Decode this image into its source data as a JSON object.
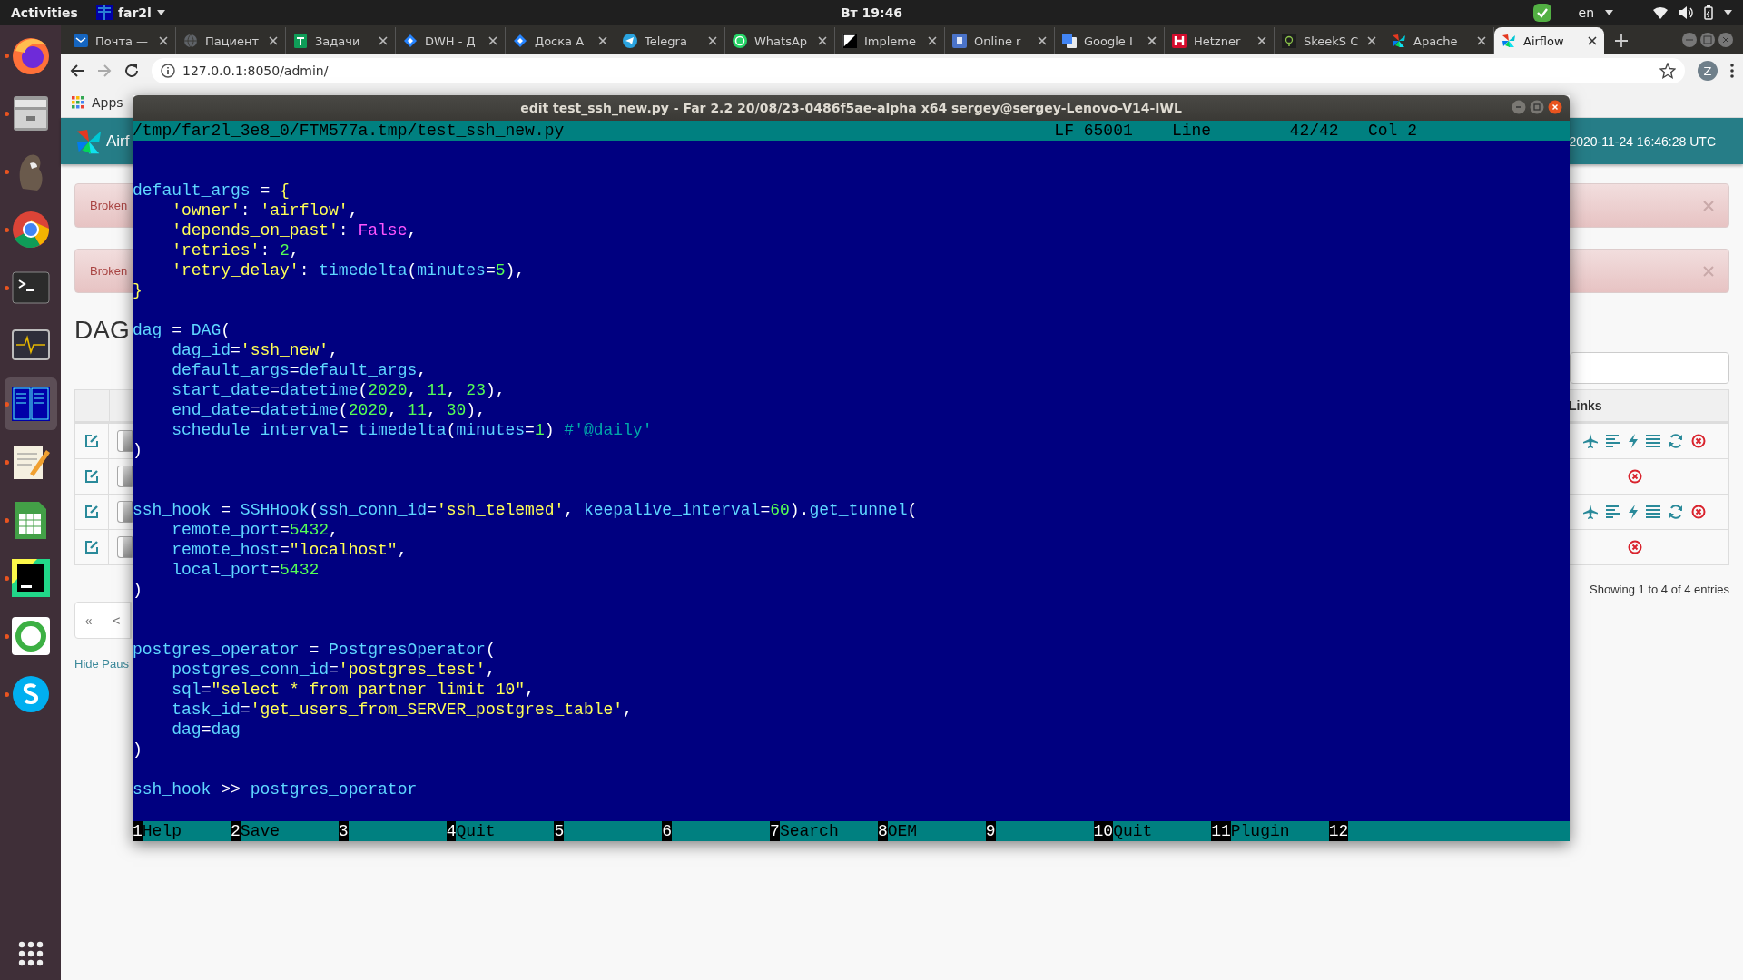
{
  "top_bar": {
    "activities": "Activities",
    "app_menu": "far2l",
    "clock": "Вт 19:46",
    "keyboard_layout": "en"
  },
  "dock": {
    "apps": [
      {
        "kind": "firefox",
        "running": true,
        "selected": false
      },
      {
        "kind": "files",
        "running": true,
        "selected": false
      },
      {
        "kind": "beaver",
        "running": true,
        "selected": false
      },
      {
        "kind": "chrome",
        "running": true,
        "selected": false
      },
      {
        "kind": "terminal",
        "running": true,
        "selected": false
      },
      {
        "kind": "monitor",
        "running": false,
        "selected": false
      },
      {
        "kind": "far",
        "running": true,
        "selected": true
      },
      {
        "kind": "editor",
        "running": true,
        "selected": false
      },
      {
        "kind": "calc",
        "running": true,
        "selected": false
      },
      {
        "kind": "pycharm",
        "running": true,
        "selected": false
      },
      {
        "kind": "ring",
        "running": true,
        "selected": false
      },
      {
        "kind": "skype",
        "running": true,
        "selected": false
      }
    ]
  },
  "browser": {
    "tabs": [
      {
        "label": "Почта —",
        "kind": "mail",
        "selected": false
      },
      {
        "label": "Пациент",
        "kind": "globe",
        "selected": false
      },
      {
        "label": "Задачи",
        "kind": "sheet",
        "selected": false
      },
      {
        "label": "DWH - Д",
        "kind": "diamond",
        "selected": false
      },
      {
        "label": "Доска А",
        "kind": "diamond",
        "selected": false
      },
      {
        "label": "Telegra",
        "kind": "telegram",
        "selected": false
      },
      {
        "label": "WhatsAp",
        "kind": "whatsapp",
        "selected": false
      },
      {
        "label": "Impleme",
        "kind": "split",
        "selected": false
      },
      {
        "label": "Online r",
        "kind": "tile-blue",
        "selected": false
      },
      {
        "label": "Google I",
        "kind": "translate",
        "selected": false
      },
      {
        "label": "Hetzner",
        "kind": "tile-red",
        "selected": false
      },
      {
        "label": "SkeekS C",
        "kind": "bulb",
        "selected": false
      },
      {
        "label": "Apache",
        "kind": "pinwheel",
        "selected": false
      },
      {
        "label": "Airflow",
        "kind": "pinwheel",
        "selected": true
      }
    ],
    "address": "127.0.0.1:8050/admin/",
    "profile_initial": "Z",
    "bookmarks": [
      "Apps"
    ]
  },
  "airflow_page": {
    "brand": "Airf",
    "timestamp": "2020-11-24 16:46:28 UTC",
    "alerts": [
      "Broken",
      "Broken"
    ],
    "title": "DAG",
    "table": {
      "links_header": "Links",
      "rows": [
        {
          "kind": "full",
          "on": false
        },
        {
          "kind": "delete",
          "on": false
        },
        {
          "kind": "full",
          "on": false
        },
        {
          "kind": "delete",
          "on": false
        }
      ]
    },
    "info": "Showing 1 to 4 of 4 entries",
    "pagination": [
      "«",
      "<"
    ],
    "hide_paused": "Hide Paus"
  },
  "editor": {
    "title": "edit test_ssh_new.py - Far 2.2 20/08/23-0486f5ae-alpha x64 sergey@sergey-Lenovo-V14-IWL",
    "status": [
      "/tmp/far2l_3e8_0/FTM577a.tmp/test_ssh_new.py",
      "LF 65001",
      "Line",
      "42/42",
      "Col 2"
    ],
    "lines": [
      {
        "kind": "blank"
      },
      {
        "kind": "blank"
      },
      {
        "kind": "code",
        "tokens": [
          {
            "text": "default_args",
            "kind": "id"
          },
          {
            "text": " = ",
            "kind": "op"
          },
          {
            "text": "{",
            "kind": "brace"
          }
        ]
      },
      {
        "kind": "code",
        "tokens": [
          {
            "text": "    'owner'",
            "kind": "str"
          },
          {
            "text": ": ",
            "kind": "op"
          },
          {
            "text": "'airflow'",
            "kind": "str"
          },
          {
            "text": ",",
            "kind": "op"
          }
        ]
      },
      {
        "kind": "code",
        "tokens": [
          {
            "text": "    'depends_on_past'",
            "kind": "str"
          },
          {
            "text": ": ",
            "kind": "op"
          },
          {
            "text": "False",
            "kind": "kw"
          },
          {
            "text": ",",
            "kind": "op"
          }
        ]
      },
      {
        "kind": "code",
        "tokens": [
          {
            "text": "    'retries'",
            "kind": "str"
          },
          {
            "text": ": ",
            "kind": "op"
          },
          {
            "text": "2",
            "kind": "num"
          },
          {
            "text": ",",
            "kind": "op"
          }
        ]
      },
      {
        "kind": "code",
        "tokens": [
          {
            "text": "    'retry_delay'",
            "kind": "str"
          },
          {
            "text": ": ",
            "kind": "op"
          },
          {
            "text": "timedelta",
            "kind": "id"
          },
          {
            "text": "(",
            "kind": "op"
          },
          {
            "text": "minutes",
            "kind": "id"
          },
          {
            "text": "=",
            "kind": "op"
          },
          {
            "text": "5",
            "kind": "num"
          },
          {
            "text": "),",
            "kind": "op"
          }
        ]
      },
      {
        "kind": "code",
        "tokens": [
          {
            "text": "}",
            "kind": "brace"
          }
        ]
      },
      {
        "kind": "blank"
      },
      {
        "kind": "code",
        "tokens": [
          {
            "text": "dag",
            "kind": "id"
          },
          {
            "text": " = ",
            "kind": "op"
          },
          {
            "text": "DAG",
            "kind": "id"
          },
          {
            "text": "(",
            "kind": "op"
          }
        ]
      },
      {
        "kind": "code",
        "tokens": [
          {
            "text": "    dag_id",
            "kind": "id"
          },
          {
            "text": "=",
            "kind": "op"
          },
          {
            "text": "'ssh_new'",
            "kind": "str"
          },
          {
            "text": ",",
            "kind": "op"
          }
        ]
      },
      {
        "kind": "code",
        "tokens": [
          {
            "text": "    default_args",
            "kind": "id"
          },
          {
            "text": "=",
            "kind": "op"
          },
          {
            "text": "default_args",
            "kind": "id"
          },
          {
            "text": ",",
            "kind": "op"
          }
        ]
      },
      {
        "kind": "code",
        "tokens": [
          {
            "text": "    start_date",
            "kind": "id"
          },
          {
            "text": "=",
            "kind": "op"
          },
          {
            "text": "datetime",
            "kind": "id"
          },
          {
            "text": "(",
            "kind": "op"
          },
          {
            "text": "2020",
            "kind": "num"
          },
          {
            "text": ", ",
            "kind": "op"
          },
          {
            "text": "11",
            "kind": "num"
          },
          {
            "text": ", ",
            "kind": "op"
          },
          {
            "text": "23",
            "kind": "num"
          },
          {
            "text": "),",
            "kind": "op"
          }
        ]
      },
      {
        "kind": "code",
        "tokens": [
          {
            "text": "    end_date",
            "kind": "id"
          },
          {
            "text": "=",
            "kind": "op"
          },
          {
            "text": "datetime",
            "kind": "id"
          },
          {
            "text": "(",
            "kind": "op"
          },
          {
            "text": "2020",
            "kind": "num"
          },
          {
            "text": ", ",
            "kind": "op"
          },
          {
            "text": "11",
            "kind": "num"
          },
          {
            "text": ", ",
            "kind": "op"
          },
          {
            "text": "30",
            "kind": "num"
          },
          {
            "text": "),",
            "kind": "op"
          }
        ]
      },
      {
        "kind": "code",
        "tokens": [
          {
            "text": "    schedule_interval",
            "kind": "id"
          },
          {
            "text": "= ",
            "kind": "op"
          },
          {
            "text": "timedelta",
            "kind": "id"
          },
          {
            "text": "(",
            "kind": "op"
          },
          {
            "text": "minutes",
            "kind": "id"
          },
          {
            "text": "=",
            "kind": "op"
          },
          {
            "text": "1",
            "kind": "num"
          },
          {
            "text": ") ",
            "kind": "op"
          },
          {
            "text": "#'@daily'",
            "kind": "cmt"
          }
        ]
      },
      {
        "kind": "code",
        "tokens": [
          {
            "text": ")",
            "kind": "op"
          }
        ]
      },
      {
        "kind": "blank"
      },
      {
        "kind": "blank"
      },
      {
        "kind": "code",
        "tokens": [
          {
            "text": "ssh_hook",
            "kind": "id"
          },
          {
            "text": " = ",
            "kind": "op"
          },
          {
            "text": "SSHHook",
            "kind": "id"
          },
          {
            "text": "(",
            "kind": "op"
          },
          {
            "text": "ssh_conn_id",
            "kind": "id"
          },
          {
            "text": "=",
            "kind": "op"
          },
          {
            "text": "'ssh_telemed'",
            "kind": "str"
          },
          {
            "text": ", ",
            "kind": "op"
          },
          {
            "text": "keepalive_interval",
            "kind": "id"
          },
          {
            "text": "=",
            "kind": "op"
          },
          {
            "text": "60",
            "kind": "num"
          },
          {
            "text": ").",
            "kind": "op"
          },
          {
            "text": "get_tunnel",
            "kind": "id"
          },
          {
            "text": "(",
            "kind": "op"
          }
        ]
      },
      {
        "kind": "code",
        "tokens": [
          {
            "text": "    remote_port",
            "kind": "id"
          },
          {
            "text": "=",
            "kind": "op"
          },
          {
            "text": "5432",
            "kind": "num"
          },
          {
            "text": ",",
            "kind": "op"
          }
        ]
      },
      {
        "kind": "code",
        "tokens": [
          {
            "text": "    remote_host",
            "kind": "id"
          },
          {
            "text": "=",
            "kind": "op"
          },
          {
            "text": "\"localhost\"",
            "kind": "str"
          },
          {
            "text": ",",
            "kind": "op"
          }
        ]
      },
      {
        "kind": "code",
        "tokens": [
          {
            "text": "    local_port",
            "kind": "id"
          },
          {
            "text": "=",
            "kind": "op"
          },
          {
            "text": "5432",
            "kind": "num"
          }
        ]
      },
      {
        "kind": "code",
        "tokens": [
          {
            "text": ")",
            "kind": "op"
          }
        ]
      },
      {
        "kind": "blank"
      },
      {
        "kind": "blank"
      },
      {
        "kind": "code",
        "tokens": [
          {
            "text": "postgres_operator",
            "kind": "id"
          },
          {
            "text": " = ",
            "kind": "op"
          },
          {
            "text": "PostgresOperator",
            "kind": "id"
          },
          {
            "text": "(",
            "kind": "op"
          }
        ]
      },
      {
        "kind": "code",
        "tokens": [
          {
            "text": "    postgres_conn_id",
            "kind": "id"
          },
          {
            "text": "=",
            "kind": "op"
          },
          {
            "text": "'postgres_test'",
            "kind": "str"
          },
          {
            "text": ",",
            "kind": "op"
          }
        ]
      },
      {
        "kind": "code",
        "tokens": [
          {
            "text": "    sql",
            "kind": "id"
          },
          {
            "text": "=",
            "kind": "op"
          },
          {
            "text": "\"select * from partner limit 10\"",
            "kind": "str"
          },
          {
            "text": ",",
            "kind": "op"
          }
        ]
      },
      {
        "kind": "code",
        "tokens": [
          {
            "text": "    task_id",
            "kind": "id"
          },
          {
            "text": "=",
            "kind": "op"
          },
          {
            "text": "'get_users_from_SERVER_postgres_table'",
            "kind": "str"
          },
          {
            "text": ",",
            "kind": "op"
          }
        ]
      },
      {
        "kind": "code",
        "tokens": [
          {
            "text": "    dag",
            "kind": "id"
          },
          {
            "text": "=",
            "kind": "op"
          },
          {
            "text": "dag",
            "kind": "id"
          }
        ]
      },
      {
        "kind": "code",
        "tokens": [
          {
            "text": ")",
            "kind": "op"
          }
        ]
      },
      {
        "kind": "blank"
      },
      {
        "kind": "code",
        "tokens": [
          {
            "text": "ssh_hook",
            "kind": "id"
          },
          {
            "text": " >> ",
            "kind": "op"
          },
          {
            "text": "postgres_operator",
            "kind": "id"
          }
        ]
      },
      {
        "kind": "blank"
      }
    ],
    "keys": [
      {
        "num": "1",
        "label": "Help"
      },
      {
        "num": "2",
        "label": "Save"
      },
      {
        "num": "3"
      },
      {
        "num": "4",
        "label": "Quit"
      },
      {
        "num": "5"
      },
      {
        "num": "6"
      },
      {
        "num": "7",
        "label": "Search"
      },
      {
        "num": "8",
        "label": "OEM"
      },
      {
        "num": "9"
      },
      {
        "num": "10",
        "label": "Quit"
      },
      {
        "num": "11",
        "label": "Plugin"
      },
      {
        "num": "12"
      }
    ]
  }
}
